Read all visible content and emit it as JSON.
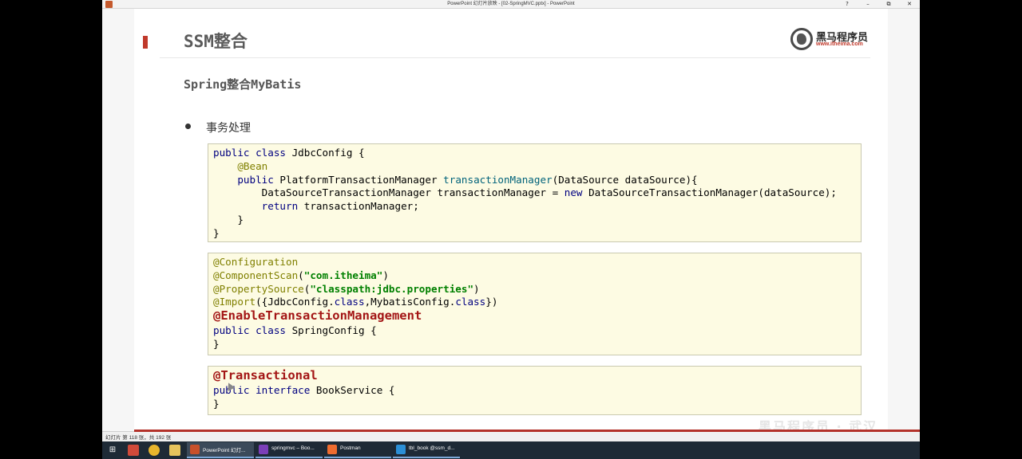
{
  "window": {
    "title": "PowerPoint 幻灯片放映 - [02-SpringMVC.pptx] - PowerPoint",
    "controls": [
      "?",
      "–",
      "⧉",
      "✕"
    ]
  },
  "slide": {
    "title": "SSM整合",
    "subtitle": "Spring整合MyBatis",
    "bullet": "事务处理",
    "logo": {
      "name": "黑马程序员",
      "url": "www.itheima.com"
    },
    "code_blocks": [
      {
        "lines": [
          [
            {
              "t": "public class",
              "c": "kw"
            },
            {
              "t": " JdbcConfig {",
              "c": ""
            }
          ],
          [
            {
              "t": "    ",
              "c": ""
            },
            {
              "t": "@Bean",
              "c": "ann"
            }
          ],
          [
            {
              "t": "    ",
              "c": ""
            },
            {
              "t": "public",
              "c": "kw"
            },
            {
              "t": " PlatformTransactionManager ",
              "c": ""
            },
            {
              "t": "transactionManager",
              "c": "method"
            },
            {
              "t": "(DataSource dataSource){",
              "c": ""
            }
          ],
          [
            {
              "t": "        DataSourceTransactionManager transactionManager = ",
              "c": ""
            },
            {
              "t": "new",
              "c": "kw"
            },
            {
              "t": " DataSourceTransactionManager(dataSource);",
              "c": ""
            }
          ],
          [
            {
              "t": "        ",
              "c": ""
            },
            {
              "t": "return",
              "c": "kw"
            },
            {
              "t": " transactionManager;",
              "c": ""
            }
          ],
          [
            {
              "t": "    }",
              "c": ""
            }
          ],
          [
            {
              "t": "}",
              "c": ""
            }
          ]
        ]
      },
      {
        "lines": [
          [
            {
              "t": "@Configuration",
              "c": "ann"
            }
          ],
          [
            {
              "t": "@ComponentScan",
              "c": "ann"
            },
            {
              "t": "(",
              "c": ""
            },
            {
              "t": "\"com.itheima\"",
              "c": "str"
            },
            {
              "t": ")",
              "c": ""
            }
          ],
          [
            {
              "t": "@PropertySource",
              "c": "ann"
            },
            {
              "t": "(",
              "c": ""
            },
            {
              "t": "\"classpath:jdbc.properties\"",
              "c": "str"
            },
            {
              "t": ")",
              "c": ""
            }
          ],
          [
            {
              "t": "@Import",
              "c": "ann"
            },
            {
              "t": "({JdbcConfig.",
              "c": ""
            },
            {
              "t": "class",
              "c": "kw"
            },
            {
              "t": ",MybatisConfig.",
              "c": ""
            },
            {
              "t": "class",
              "c": "kw"
            },
            {
              "t": "})",
              "c": ""
            }
          ],
          [
            {
              "t": "@EnableTransactionManagement",
              "c": "ann-big"
            }
          ],
          [
            {
              "t": "public class",
              "c": "kw"
            },
            {
              "t": " SpringConfig {",
              "c": ""
            }
          ],
          [
            {
              "t": "}",
              "c": ""
            }
          ]
        ]
      },
      {
        "lines": [
          [
            {
              "t": "@Transactional",
              "c": "ann-big"
            }
          ],
          [
            {
              "t": "public interface",
              "c": "kw"
            },
            {
              "t": " BookService {",
              "c": ""
            }
          ],
          [
            {
              "t": "}",
              "c": ""
            }
          ]
        ]
      }
    ]
  },
  "statusbar": {
    "text": "幻灯片 第 118 张，共 192 张",
    "watermark": "黑马程序员 · 武汉"
  },
  "taskbar": {
    "tasks": [
      {
        "label": "PowerPoint 幻灯...",
        "color": "#c8502a",
        "active": true
      },
      {
        "label": "springmvc – Boo...",
        "color": "#7b3fb8",
        "active": false
      },
      {
        "label": "Postman",
        "color": "#ef6c2f",
        "active": false
      },
      {
        "label": "tbl_book @ssm_d...",
        "color": "#2b8fd6",
        "active": false
      }
    ]
  }
}
